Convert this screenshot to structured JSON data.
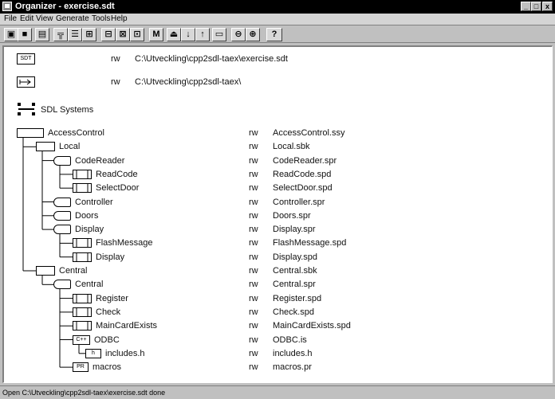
{
  "window": {
    "title": "Organizer - exercise.sdt",
    "controls": {
      "minimize": "_",
      "maximize": "□",
      "close": "x"
    }
  },
  "menu": [
    "File",
    "Edit",
    "View",
    "Generate",
    "Tools",
    "Help"
  ],
  "toolbar": {
    "buttons": [
      {
        "icon": "open-folder-icon"
      },
      {
        "icon": "save-icon"
      },
      {
        "icon": "print-icon"
      },
      {
        "icon": "structure-icon"
      },
      {
        "icon": "edit-icon"
      },
      {
        "icon": "connect-icon"
      },
      {
        "icon": "analyze-icon"
      },
      {
        "icon": "make-icon"
      },
      {
        "icon": "link-icon"
      },
      {
        "icon": "find-icon"
      },
      {
        "icon": "upload-icon"
      },
      {
        "icon": "down-arrow-icon"
      },
      {
        "icon": "up-arrow-icon"
      },
      {
        "icon": "window-icon"
      },
      {
        "icon": "zoom-out-icon"
      },
      {
        "icon": "zoom-in-icon"
      },
      {
        "icon": "help-icon"
      }
    ],
    "help_label": "?"
  },
  "header_rows": [
    {
      "icon": "sdt-icon",
      "icon_text": "SDT",
      "perm": "rw",
      "path": "C:\\Utveckling\\cpp2sdl-taex\\exercise.sdt"
    },
    {
      "icon": "source-dir-icon",
      "icon_text": "",
      "perm": "rw",
      "path": "C:\\Utveckling\\cpp2sdl-taex\\"
    }
  ],
  "chapter": {
    "icon": "sdl-systems-icon",
    "label": "SDL Systems"
  },
  "tree": [
    {
      "label": "AccessControl",
      "icon": "system-icon",
      "level": 0,
      "perm": "rw",
      "file": "AccessControl.ssy"
    },
    {
      "label": "Local",
      "icon": "block-icon",
      "level": 1,
      "perm": "rw",
      "file": "Local.sbk"
    },
    {
      "label": "CodeReader",
      "icon": "process-icon",
      "level": 2,
      "perm": "rw",
      "file": "CodeReader.spr"
    },
    {
      "label": "ReadCode",
      "icon": "procedure-icon",
      "level": 3,
      "perm": "rw",
      "file": "ReadCode.spd"
    },
    {
      "label": "SelectDoor",
      "icon": "procedure-icon",
      "level": 3,
      "perm": "rw",
      "file": "SelectDoor.spd"
    },
    {
      "label": "Controller",
      "icon": "process-icon",
      "level": 2,
      "perm": "rw",
      "file": "Controller.spr"
    },
    {
      "label": "Doors",
      "icon": "process-icon",
      "level": 2,
      "perm": "rw",
      "file": "Doors.spr"
    },
    {
      "label": "Display",
      "icon": "process-icon",
      "level": 2,
      "perm": "rw",
      "file": "Display.spr"
    },
    {
      "label": "FlashMessage",
      "icon": "procedure-icon",
      "level": 3,
      "perm": "rw",
      "file": "FlashMessage.spd"
    },
    {
      "label": "Display",
      "icon": "procedure-icon",
      "level": 3,
      "perm": "rw",
      "file": "Display.spd"
    },
    {
      "label": "Central",
      "icon": "block-icon",
      "level": 1,
      "perm": "rw",
      "file": "Central.sbk"
    },
    {
      "label": "Central",
      "icon": "process-icon",
      "level": 2,
      "perm": "rw",
      "file": "Central.spr"
    },
    {
      "label": "Register",
      "icon": "procedure-icon",
      "level": 3,
      "perm": "rw",
      "file": "Register.spd"
    },
    {
      "label": "Check",
      "icon": "procedure-icon",
      "level": 3,
      "perm": "rw",
      "file": "Check.spd"
    },
    {
      "label": "MainCardExists",
      "icon": "procedure-icon",
      "level": 3,
      "perm": "rw",
      "file": "MainCardExists.spd"
    },
    {
      "label": "ODBC",
      "icon": "cpp-import-icon",
      "icon_text": "C++",
      "level": 3,
      "perm": "rw",
      "file": "ODBC.is"
    },
    {
      "label": "includes.h",
      "icon": "header-file-icon",
      "icon_text": "h",
      "level": 4,
      "perm": "rw",
      "file": "includes.h"
    },
    {
      "label": "macros",
      "icon": "pr-file-icon",
      "icon_text": "PR",
      "level": 3,
      "perm": "rw",
      "file": "macros.pr"
    }
  ],
  "status": "Open C:\\Utveckling\\cpp2sdl-taex\\exercise.sdt done"
}
